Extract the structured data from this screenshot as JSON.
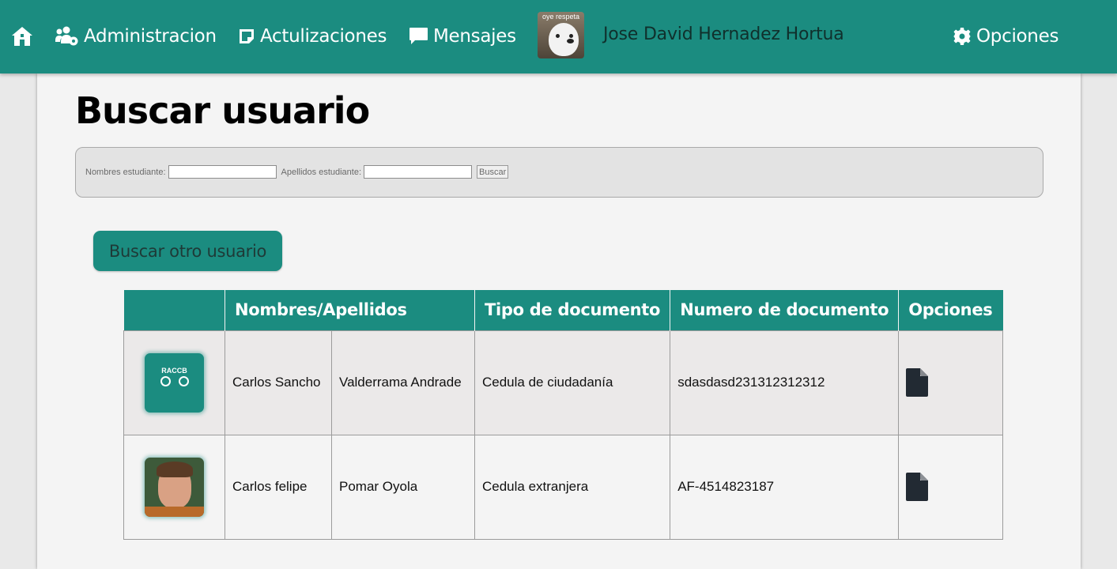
{
  "nav": {
    "home_icon": "home-icon",
    "admin_label": "Administracion",
    "updates_label": "Actulizaciones",
    "messages_label": "Mensajes",
    "avatar_caption": "oye respeta",
    "user_name": "Jose David Hernadez Hortua",
    "options_label": "Opciones"
  },
  "page": {
    "title": "Buscar usuario"
  },
  "search": {
    "first_name_label": "Nombres estudiante:",
    "first_name_value": "",
    "last_name_label": "Apellidos estudiante:",
    "last_name_value": "",
    "submit_label": "Buscar"
  },
  "search_other_label": "Buscar otro usuario",
  "table": {
    "headers": [
      "",
      "Nombres/Apellidos",
      "Tipo de documento",
      "Numero de documento",
      "Opciones"
    ],
    "rows": [
      {
        "photo": "raccb-logo",
        "photo_text": "RACCB",
        "first_name": "Carlos Sancho",
        "last_name": "Valderrama Andrade",
        "doc_type": "Cedula de ciudadanía",
        "doc_number": "sdasdasd231312312312",
        "option_icon": "document-icon"
      },
      {
        "photo": "user-photo",
        "first_name": "Carlos felipe",
        "last_name": "Pomar Oyola",
        "doc_type": "Cedula extranjera",
        "doc_number": "AF-4514823187",
        "option_icon": "document-icon"
      }
    ]
  },
  "colors": {
    "accent": "#1b8c80",
    "panel": "#f4f4f4",
    "background": "#e9e9e9"
  }
}
